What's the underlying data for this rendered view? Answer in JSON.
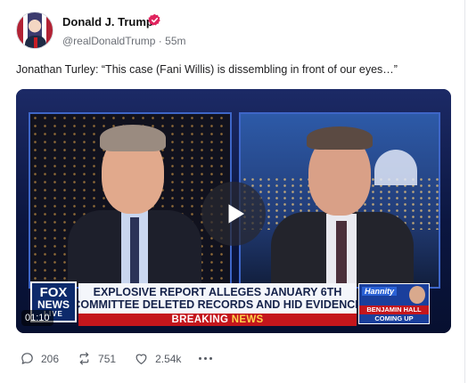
{
  "post": {
    "author": "Donald J. Trump",
    "handle": "@realDonaldTrump",
    "separator": "·",
    "age": "55m",
    "text": "Jonathan Turley: “This case (Fani Willis) is dissembling in front of our eyes…”",
    "verified_color": "#e0245e"
  },
  "video": {
    "timecode": "01:10",
    "network_logo": [
      "FOX",
      "NEWS",
      "LIVE"
    ],
    "headline": [
      "EXPLOSIVE REPORT ALLEGES JANUARY 6TH",
      "COMMITTEE DELETED RECORDS AND HID EVIDENCE"
    ],
    "breaking": "BREAKING",
    "breaking_news": "NEWS",
    "promo": {
      "show": "Hannity",
      "name": "BENJAMIN HALL",
      "caption": "COMING UP"
    }
  },
  "actions": {
    "replies": "206",
    "reposts": "751",
    "likes": "2.54k"
  },
  "icons": [
    "verified-badge-icon",
    "play-icon",
    "reply-icon",
    "repost-icon",
    "like-icon",
    "more-icon"
  ]
}
